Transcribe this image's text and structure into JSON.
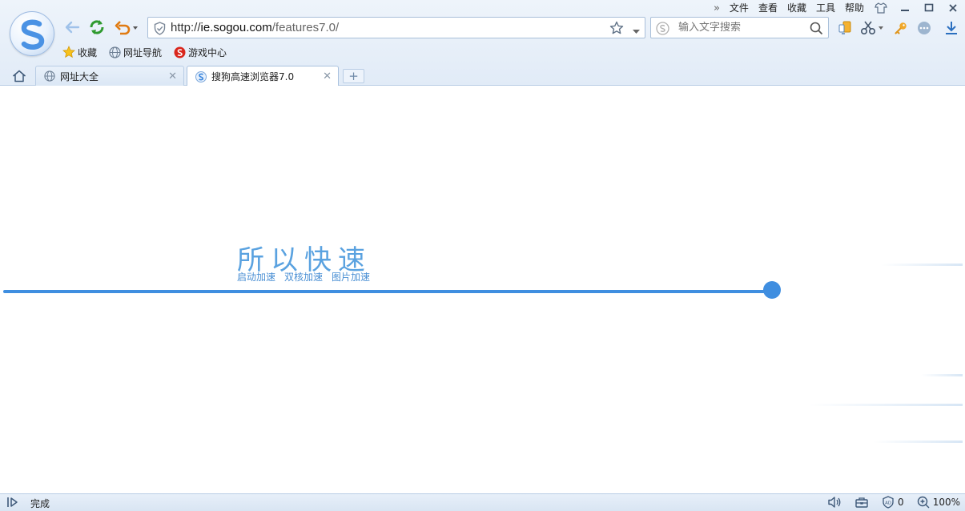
{
  "menubar": {
    "more_icon": "double-chevron-right-icon",
    "items": [
      "文件",
      "查看",
      "收藏",
      "工具",
      "帮助"
    ],
    "skin_icon": "tshirt-icon"
  },
  "window": {
    "minimize_icon": "minimize-icon",
    "maximize_icon": "maximize-icon",
    "close_icon": "close-icon"
  },
  "nav": {
    "back_icon": "arrow-left-icon",
    "refresh_icon": "refresh-icon",
    "undo_icon": "undo-icon"
  },
  "address": {
    "scheme": "http://",
    "host": "ie.sogou.com",
    "path": "/features7.0/",
    "shield_icon": "shield-icon",
    "favorite_icon": "star-icon",
    "dropdown_icon": "chevron-down-icon"
  },
  "search": {
    "placeholder": "输入文字搜索",
    "engine_icon": "sogou-s-icon",
    "search_icon": "magnifier-icon"
  },
  "toolbar_icons": [
    "sync-icon",
    "scissors-icon",
    "key-icon",
    "more-icon",
    "download-icon"
  ],
  "favorites": [
    {
      "label": "收藏",
      "icon": "star-icon"
    },
    {
      "label": "网址导航",
      "icon": "globe-icon"
    },
    {
      "label": "游戏中心",
      "icon": "game-icon"
    }
  ],
  "tabs": [
    {
      "label": "网址大全",
      "icon": "globe-icon",
      "active": false
    },
    {
      "label": "搜狗高速浏览器7.0",
      "icon": "sogou-s-icon",
      "active": true
    }
  ],
  "new_tab_label": "+",
  "page": {
    "headline": "所以快速",
    "sublinks": [
      "启动加速",
      "双核加速",
      "图片加速"
    ],
    "accent_color": "#3f8ee0"
  },
  "status": {
    "text": "完成",
    "adblock_count": "0",
    "zoom": "100%"
  }
}
